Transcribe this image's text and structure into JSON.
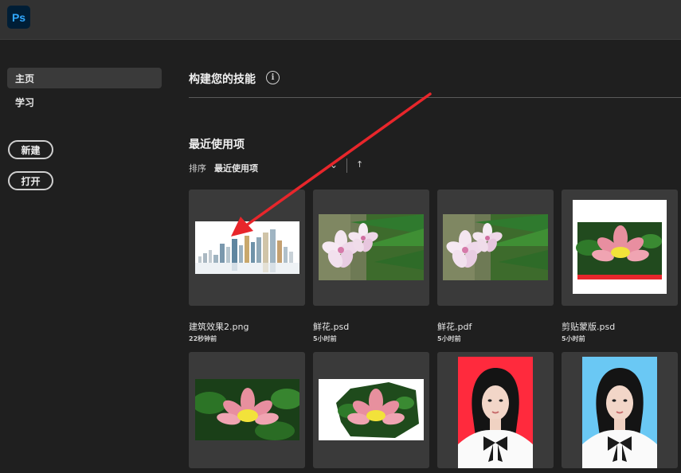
{
  "app": {
    "logo_text": "Ps"
  },
  "sidebar": {
    "items": [
      {
        "label": "主页",
        "active": true
      },
      {
        "label": "学习",
        "active": false
      }
    ],
    "buttons": {
      "new_label": "新建",
      "open_label": "打开"
    }
  },
  "main": {
    "skills_title": "构建您的技能",
    "info_icon": "i",
    "recent_title": "最近使用项",
    "sort": {
      "label": "排序",
      "value": "最近使用项",
      "chevron": "⌄",
      "direction": "↑"
    },
    "files": [
      {
        "name": "建筑效果2.png",
        "time": "22秒钟前",
        "thumb": "city-skyline"
      },
      {
        "name": "鲜花.psd",
        "time": "5小时前",
        "thumb": "flower-plumeria"
      },
      {
        "name": "鲜花.pdf",
        "time": "5小时前",
        "thumb": "flower-plumeria"
      },
      {
        "name": "剪贴蒙版.psd",
        "time": "5小时前",
        "thumb": "lotus-framed"
      },
      {
        "name": "",
        "time": "",
        "thumb": "lotus"
      },
      {
        "name": "",
        "time": "",
        "thumb": "lotus-cutout"
      },
      {
        "name": "",
        "time": "",
        "thumb": "portrait-red"
      },
      {
        "name": "",
        "time": "",
        "thumb": "portrait-blue"
      }
    ]
  },
  "colors": {
    "annotation_arrow": "#e8262b",
    "ps_brand": "#31a8ff",
    "portrait_red_bg": "#ff2a3d",
    "portrait_blue_bg": "#6ac8f4"
  }
}
